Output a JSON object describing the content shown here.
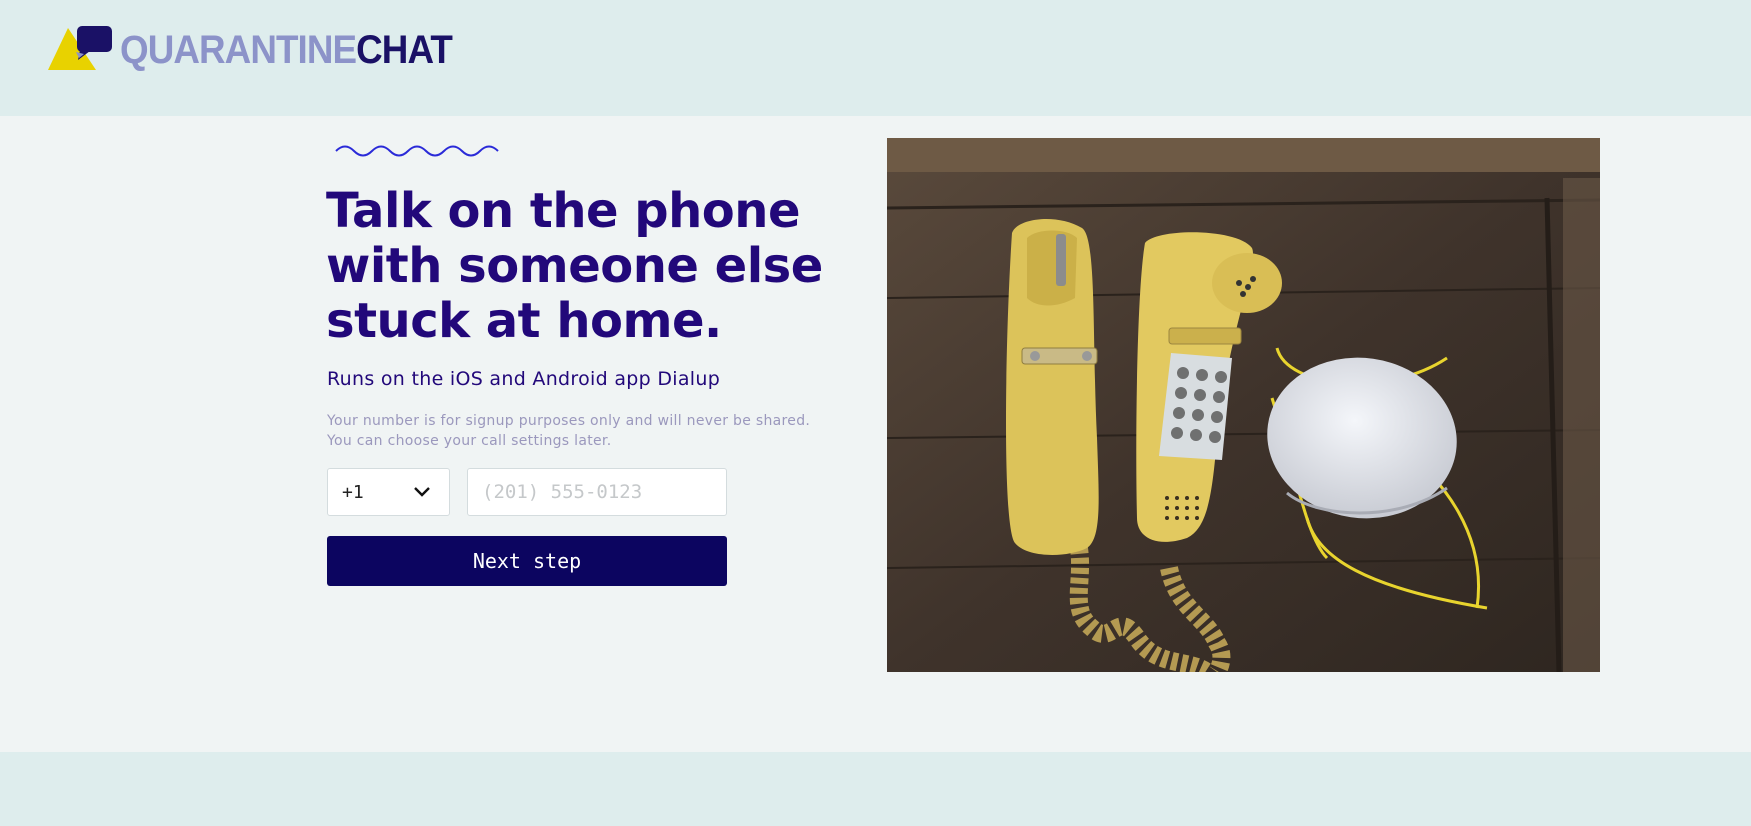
{
  "brand": {
    "name_part1": "QUARANTINE",
    "name_part2": "CHAT",
    "colors": {
      "light": "#8c93c9",
      "dark": "#1a1166",
      "yellow": "#e8d200"
    }
  },
  "hero": {
    "headline": "Talk on the phone with someone else stuck at home.",
    "subhead": "Runs on the iOS and Android app Dialup",
    "note_line1": "Your number is for signup purposes only and will never be shared.",
    "note_line2": "You can choose your call settings later."
  },
  "form": {
    "country_code": "+1",
    "phone_placeholder": "(201) 555-0123",
    "phone_value": "",
    "next_label": "Next step"
  },
  "colors": {
    "heading": "#22087a",
    "button": "#0c0560",
    "header_bg": "#deeded",
    "main_bg": "#f0f4f4"
  }
}
